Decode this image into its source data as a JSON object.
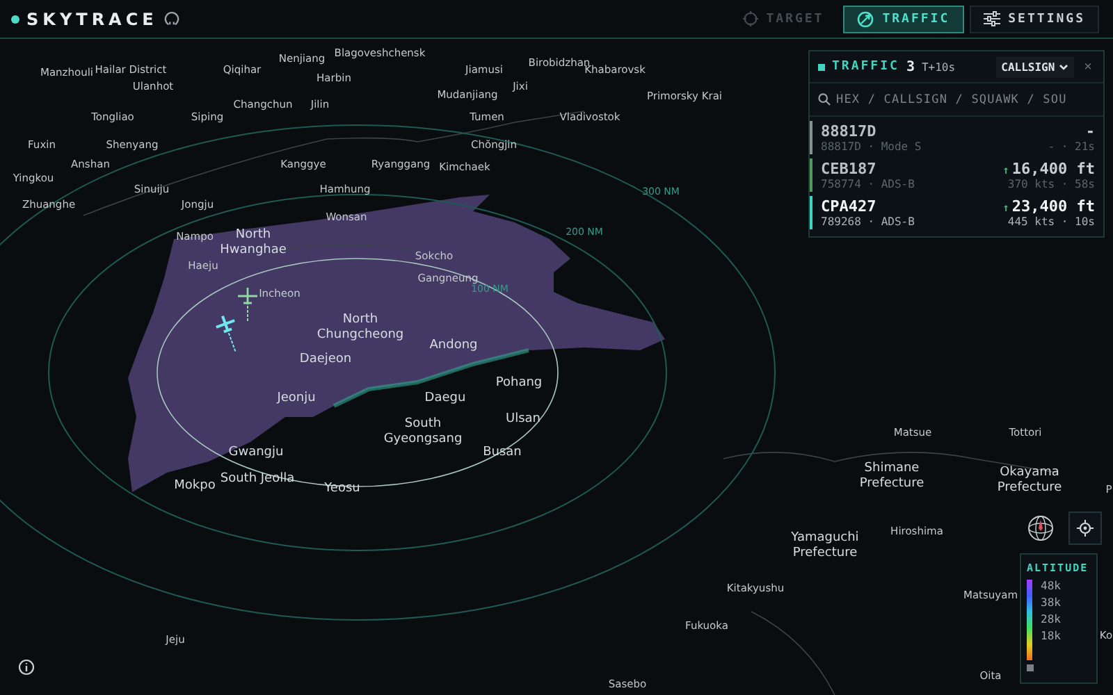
{
  "app": {
    "title": "SKYTRACE"
  },
  "nav": [
    {
      "kind": "target",
      "label": "TARGET",
      "selected": false,
      "disabled": true
    },
    {
      "kind": "traffic",
      "label": "TRAFFIC",
      "selected": true,
      "disabled": false
    },
    {
      "kind": "settings",
      "label": "SETTINGS",
      "selected": false,
      "disabled": false
    }
  ],
  "traffic": {
    "title": "TRAFFIC",
    "count": "3",
    "age": "T+10s",
    "sort": "CALLSIGN",
    "close": "×",
    "search": {
      "placeholder": "HEX / CALLSIGN / SQUAWK / SOU"
    },
    "rows": [
      {
        "callsign": "88817D",
        "trend": "",
        "altitude": "-",
        "meta": "88817D · Mode S",
        "speed": "- · 21s",
        "color": "#8a8f94",
        "selected": false
      },
      {
        "callsign": "CEB187",
        "trend": "↑",
        "altitude": "16,400 ft",
        "meta": "758774 · ADS-B",
        "speed": "370 kts · 58s",
        "color": "#4f9a5a",
        "selected": false
      },
      {
        "callsign": "CPA427",
        "trend": "↑",
        "altitude": "23,400 ft",
        "meta": "789268 · ADS-B",
        "speed": "445 kts · 10s",
        "color": "#3fd6c0",
        "selected": true
      }
    ]
  },
  "map": {
    "range_rings": [
      {
        "label": "100 NM"
      },
      {
        "label": "200 NM"
      },
      {
        "label": "300 NM"
      }
    ],
    "aircraft": [
      {
        "color": "#8fd8a0",
        "selected": false
      },
      {
        "color": "#6fe6f0",
        "selected": true
      }
    ],
    "places": [
      "Blagoveshchensk",
      "Nenjiang",
      "Birobidzhan",
      "Manzhouli",
      "Hailar District",
      "Qiqihar",
      "Jiamusi",
      "Khabarovsk",
      "Harbin",
      "Ulanhot",
      "Jixi",
      "Mudanjiang",
      "Primorsky Krai",
      "Jilin",
      "Changchun",
      "Tongliao",
      "Siping",
      "Tumen",
      "Vladivostok",
      "Fuxin",
      "Shenyang",
      "Chŏngjin",
      "Anshan",
      "Kanggye",
      "Ryanggang",
      "Kimchaek",
      "Yingkou",
      "Sinuiju",
      "Hamhung",
      "Zhuanghe",
      "Jongju",
      "Wonsan",
      "Nampo",
      "North Hwanghae",
      "Sokcho",
      "Haeju",
      "Gangneung",
      "Incheon",
      "North Chungcheong",
      "Andong",
      "Daejeon",
      "Pohang",
      "Jeonju",
      "Daegu",
      "Ulsan",
      "South Gyeongsang",
      "Matsue",
      "Tottori",
      "Gwangju",
      "Busan",
      "Mokpo",
      "South Jeolla",
      "Yeosu",
      "Shimane Prefecture",
      "Okayama Prefecture",
      "P",
      "Hiroshima",
      "Yamaguchi Prefecture",
      "Kitakyushu",
      "Matsuyam",
      "Fukuoka",
      "Jeju",
      "Ko",
      "Sasebo",
      "Oita"
    ]
  },
  "altitude_legend": {
    "title": "ALTITUDE",
    "ticks": [
      "48k",
      "38k",
      "28k",
      "18k"
    ]
  }
}
